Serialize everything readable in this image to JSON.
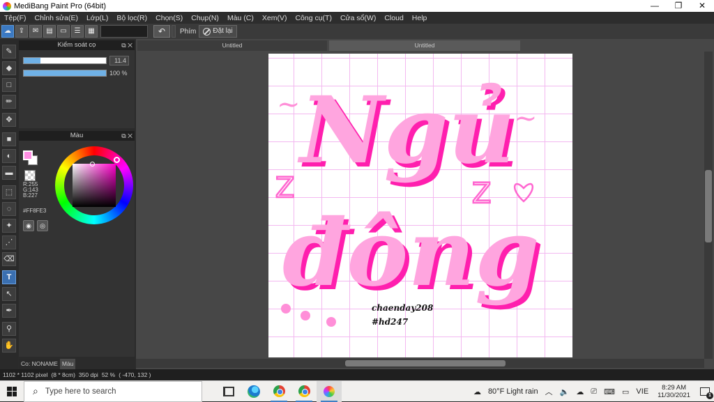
{
  "window": {
    "title": "MediBang Paint Pro (64bit)",
    "minimize": "—",
    "maximize": "❐",
    "close": "✕"
  },
  "menu": [
    "Tệp(F)",
    "Chỉnh sửa(E)",
    "Lớp(L)",
    "Bộ lọc(R)",
    "Chọn(S)",
    "Chụp(N)",
    "Màu (C)",
    "Xem(V)",
    "Công cụ(T)",
    "Cửa sổ(W)",
    "Cloud",
    "Help"
  ],
  "toolbar": {
    "undo_icon": "undo-arrow",
    "phim_label": "Phím",
    "reset_label": "Đặt lại"
  },
  "brush_panel": {
    "title": "Kiểm soát cọ",
    "size_value": "11.4",
    "size_fraction": 0.2,
    "opacity_value": "100 %",
    "opacity_fraction": 1.0
  },
  "color_panel": {
    "title": "Màu",
    "fg_color": "#FF8FE3",
    "r": "R:255",
    "g": "G:143",
    "b": "B:227",
    "hex": "#FF8FE3"
  },
  "bottom_tabs": [
    "Co: NONAME",
    "Màu"
  ],
  "doc_tabs": [
    "Untitled",
    "Untitled"
  ],
  "artwork": {
    "line1": "Ngủ",
    "line2": "đông",
    "signature1": "chaenday208",
    "signature2": "#hd247",
    "tildes": [
      "~",
      "~"
    ],
    "zs": [
      "Z",
      "Z"
    ]
  },
  "status": {
    "size": "1102 * 1102 pixel",
    "cm": "(8 * 8cm)",
    "dpi": "350 dpi",
    "zoom": "52 %",
    "coords": "( -470, 132 )"
  },
  "taskbar": {
    "search_placeholder": "Type here to search",
    "weather": "80°F  Light rain",
    "lang": "VIE",
    "time": "8:29 AM",
    "date": "11/30/2021",
    "notif_count": "1"
  }
}
